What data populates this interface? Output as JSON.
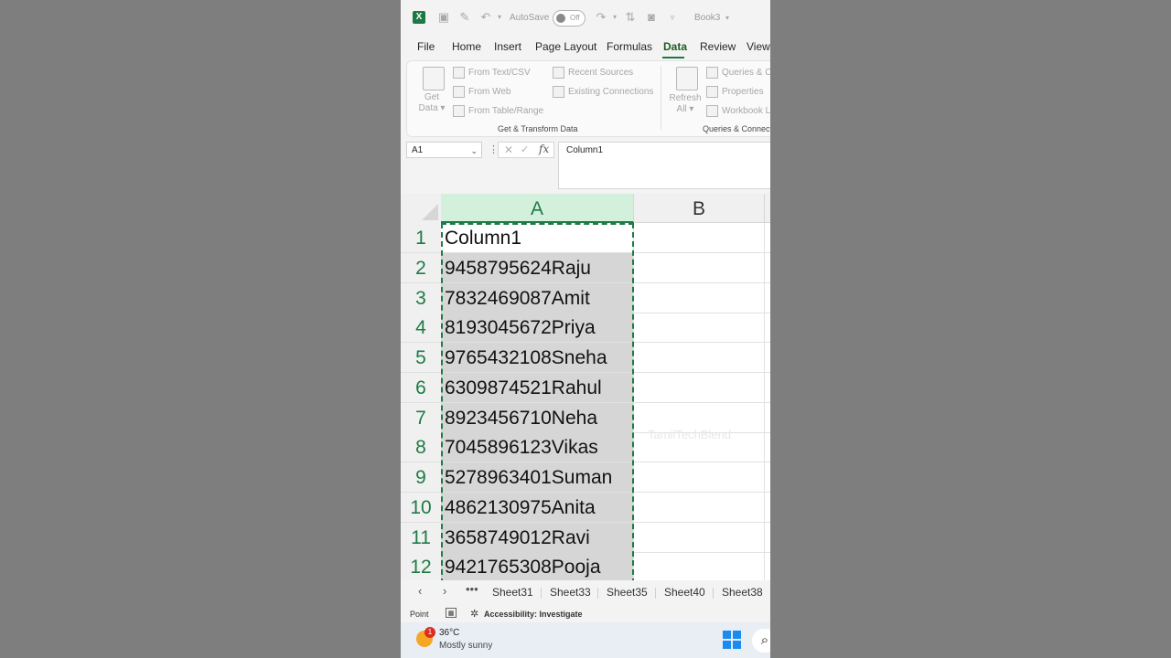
{
  "titlebar": {
    "autosave_label": "AutoSave",
    "autosave_state": "Off",
    "book_name": "Book3"
  },
  "menu": {
    "items": [
      "File",
      "Home",
      "Insert",
      "Page Layout",
      "Formulas",
      "Data",
      "Review",
      "View"
    ],
    "active": "Data"
  },
  "ribbon": {
    "get_data_line1": "Get",
    "get_data_line2": "Data",
    "from_text_csv": "From Text/CSV",
    "from_web": "From Web",
    "from_table_range": "From Table/Range",
    "recent_sources": "Recent Sources",
    "existing_connections": "Existing Connections",
    "group1_label": "Get & Transform Data",
    "refresh_line1": "Refresh",
    "refresh_line2": "All",
    "queries": "Queries & C",
    "properties": "Properties",
    "workbook_links": "Workbook Li",
    "group2_label": "Queries & Connecti"
  },
  "formula_bar": {
    "name_box": "A1",
    "formula": "Column1"
  },
  "grid": {
    "columns": [
      "A",
      "B"
    ],
    "selected_column": "A",
    "rows": [
      {
        "num": "1",
        "a": "Column1"
      },
      {
        "num": "2",
        "a": "9458795624Raju"
      },
      {
        "num": "3",
        "a": "7832469087Amit"
      },
      {
        "num": "4",
        "a": "8193045672Priya"
      },
      {
        "num": "5",
        "a": "9765432108Sneha"
      },
      {
        "num": "6",
        "a": "6309874521Rahul"
      },
      {
        "num": "7",
        "a": "8923456710Neha"
      },
      {
        "num": "8",
        "a": "7045896123Vikas"
      },
      {
        "num": "9",
        "a": "5278963401Suman"
      },
      {
        "num": "10",
        "a": "4862130975Anita"
      },
      {
        "num": "11",
        "a": "3658749012Ravi"
      },
      {
        "num": "12",
        "a": "9421765308Pooja"
      }
    ],
    "watermark": "TamilTechBlend"
  },
  "sheet_tabs": [
    "Sheet31",
    "Sheet33",
    "Sheet35",
    "Sheet40",
    "Sheet38"
  ],
  "status": {
    "mode": "Point",
    "accessibility": "Accessibility: Investigate"
  },
  "taskbar": {
    "badge": "1",
    "temperature": "36°C",
    "condition": "Mostly sunny"
  },
  "colors": {
    "excel_green": "#1e7b45",
    "selected_header_bg": "#d3f0dd",
    "taskbar_bg": "#e9eef5"
  }
}
